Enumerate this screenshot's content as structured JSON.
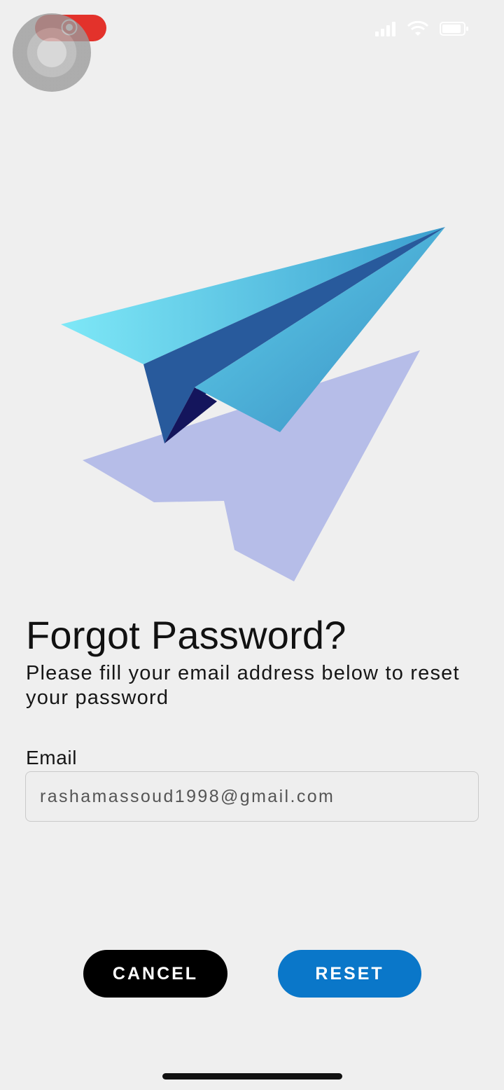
{
  "status_bar": {
    "icons": [
      "screen-record-icon",
      "assistive-touch-icon",
      "signal-icon",
      "wifi-icon",
      "battery-icon"
    ]
  },
  "hero": {
    "illustration": "paper-plane-illustration"
  },
  "forgot": {
    "title": "Forgot Password?",
    "subtitle": "Please fill your email address below to reset your password"
  },
  "email": {
    "label": "Email",
    "value": "rashamassoud1998@gmail.com"
  },
  "actions": {
    "cancel_label": "CANCEL",
    "reset_label": "RESET"
  },
  "colors": {
    "background": "#efefef",
    "reset_button": "#0a77c9",
    "cancel_button": "#000000",
    "record_pill": "#e3322b"
  }
}
